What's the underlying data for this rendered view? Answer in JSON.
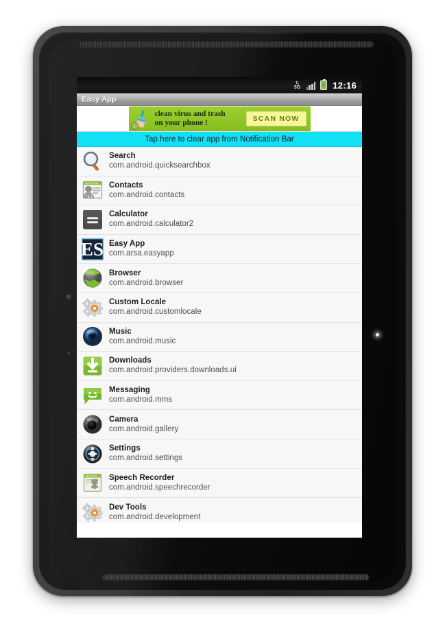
{
  "device": {
    "kind": "android-tablet",
    "speaker_top": "speaker-grille",
    "speaker_bottom": "speaker-grille"
  },
  "status_bar": {
    "data_icon": "3g-data-icon",
    "data_label": "3G",
    "signal_icon": "signal-bars-icon",
    "battery_icon": "battery-charging-icon",
    "clock": "12:16"
  },
  "app_title_bar": {
    "title": "Easy App"
  },
  "ad_banner": {
    "icon": "broom-icon",
    "info_badge": "i",
    "line1": "clean virus and trash",
    "line2": "on your phone !",
    "cta_label": "SCAN NOW",
    "bg_color": "#92c72a",
    "cta_color": "#f7f79a"
  },
  "clear_notice": {
    "label": "Tap here to clear app from Notification Bar",
    "bg_color": "#12e0f5"
  },
  "app_list": {
    "items": [
      {
        "icon": "search-magnifier-icon",
        "label": "Search",
        "package": "com.android.quicksearchbox"
      },
      {
        "icon": "contacts-card-icon",
        "label": "Contacts",
        "package": "com.android.contacts"
      },
      {
        "icon": "calculator-equals-icon",
        "label": "Calculator",
        "package": "com.android.calculator2"
      },
      {
        "icon": "easy-app-es-icon",
        "label": "Easy App",
        "package": "com.arsa.easyapp"
      },
      {
        "icon": "browser-globe-icon",
        "label": "Browser",
        "package": "com.android.browser"
      },
      {
        "icon": "custom-locale-gear-icon",
        "label": "Custom Locale",
        "package": "com.android.customlocale"
      },
      {
        "icon": "music-speaker-icon",
        "label": "Music",
        "package": "com.android.music"
      },
      {
        "icon": "downloads-arrow-icon",
        "label": "Downloads",
        "package": "com.android.providers.downloads.ui"
      },
      {
        "icon": "messaging-bubble-icon",
        "label": "Messaging",
        "package": "com.android.mms"
      },
      {
        "icon": "camera-lens-icon",
        "label": "Camera",
        "package": "com.android.gallery"
      },
      {
        "icon": "settings-dial-icon",
        "label": "Settings",
        "package": "com.android.settings"
      },
      {
        "icon": "speech-recorder-icon",
        "label": "Speech Recorder",
        "package": "com.android.speechrecorder"
      },
      {
        "icon": "dev-tools-gear-icon",
        "label": "Dev Tools",
        "package": "com.android.development"
      }
    ]
  }
}
